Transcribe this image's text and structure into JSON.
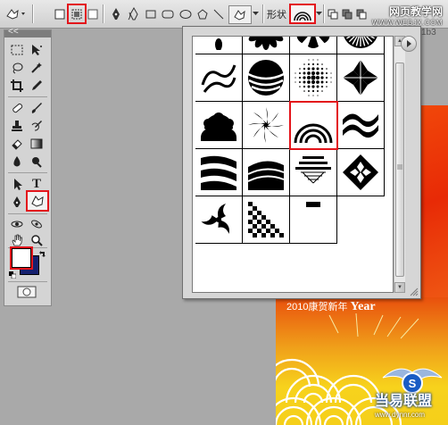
{
  "options_bar": {
    "shape_label": "形状",
    "watermark_cn": "网页教学网",
    "watermark_url": "WWW.WEBJX.COM",
    "zoom_hint": "1b3",
    "icons": [
      "custom-shape-tool-preset-icon",
      "shape-layers-mode-icon",
      "paths-mode-icon",
      "fill-pixels-mode-icon",
      "pen-icon",
      "freeform-pen-icon",
      "rectangle-icon",
      "rounded-rectangle-icon",
      "ellipse-icon",
      "polygon-icon",
      "line-icon",
      "custom-shape-icon",
      "shape-preview-arc-icon"
    ]
  },
  "tools_panel": {
    "header_glyph": "<<",
    "type_tool_label": "T",
    "colors": {
      "foreground": "#ffffff",
      "background": "#16206e"
    }
  },
  "shape_picker": {
    "shapes": [
      "flower-burst",
      "sunflower",
      "daisy-wreath",
      "radial-sunburst",
      "scroll-flourish",
      "stripes-bowl",
      "halftone-circle",
      "diamond-cross",
      "fan-scallop",
      "pinwheel",
      "arc-stack",
      "triple-wave",
      "wave-flag",
      "wave-curtain",
      "strata-grid",
      "diamond-ornament",
      "triple-swirl",
      "checker-wedge",
      "row-partial"
    ],
    "selected_shape": "arc-stack"
  },
  "canvas": {
    "year_text_cn": "2010康贺新年",
    "year_text_en": "Year",
    "logo_text": "当易联盟",
    "logo_url": "www.dynnr.com"
  },
  "colors": {
    "highlight": "#e3141b",
    "canvas_orange": "#e82a06",
    "canvas_yellow": "#f7d21c"
  }
}
